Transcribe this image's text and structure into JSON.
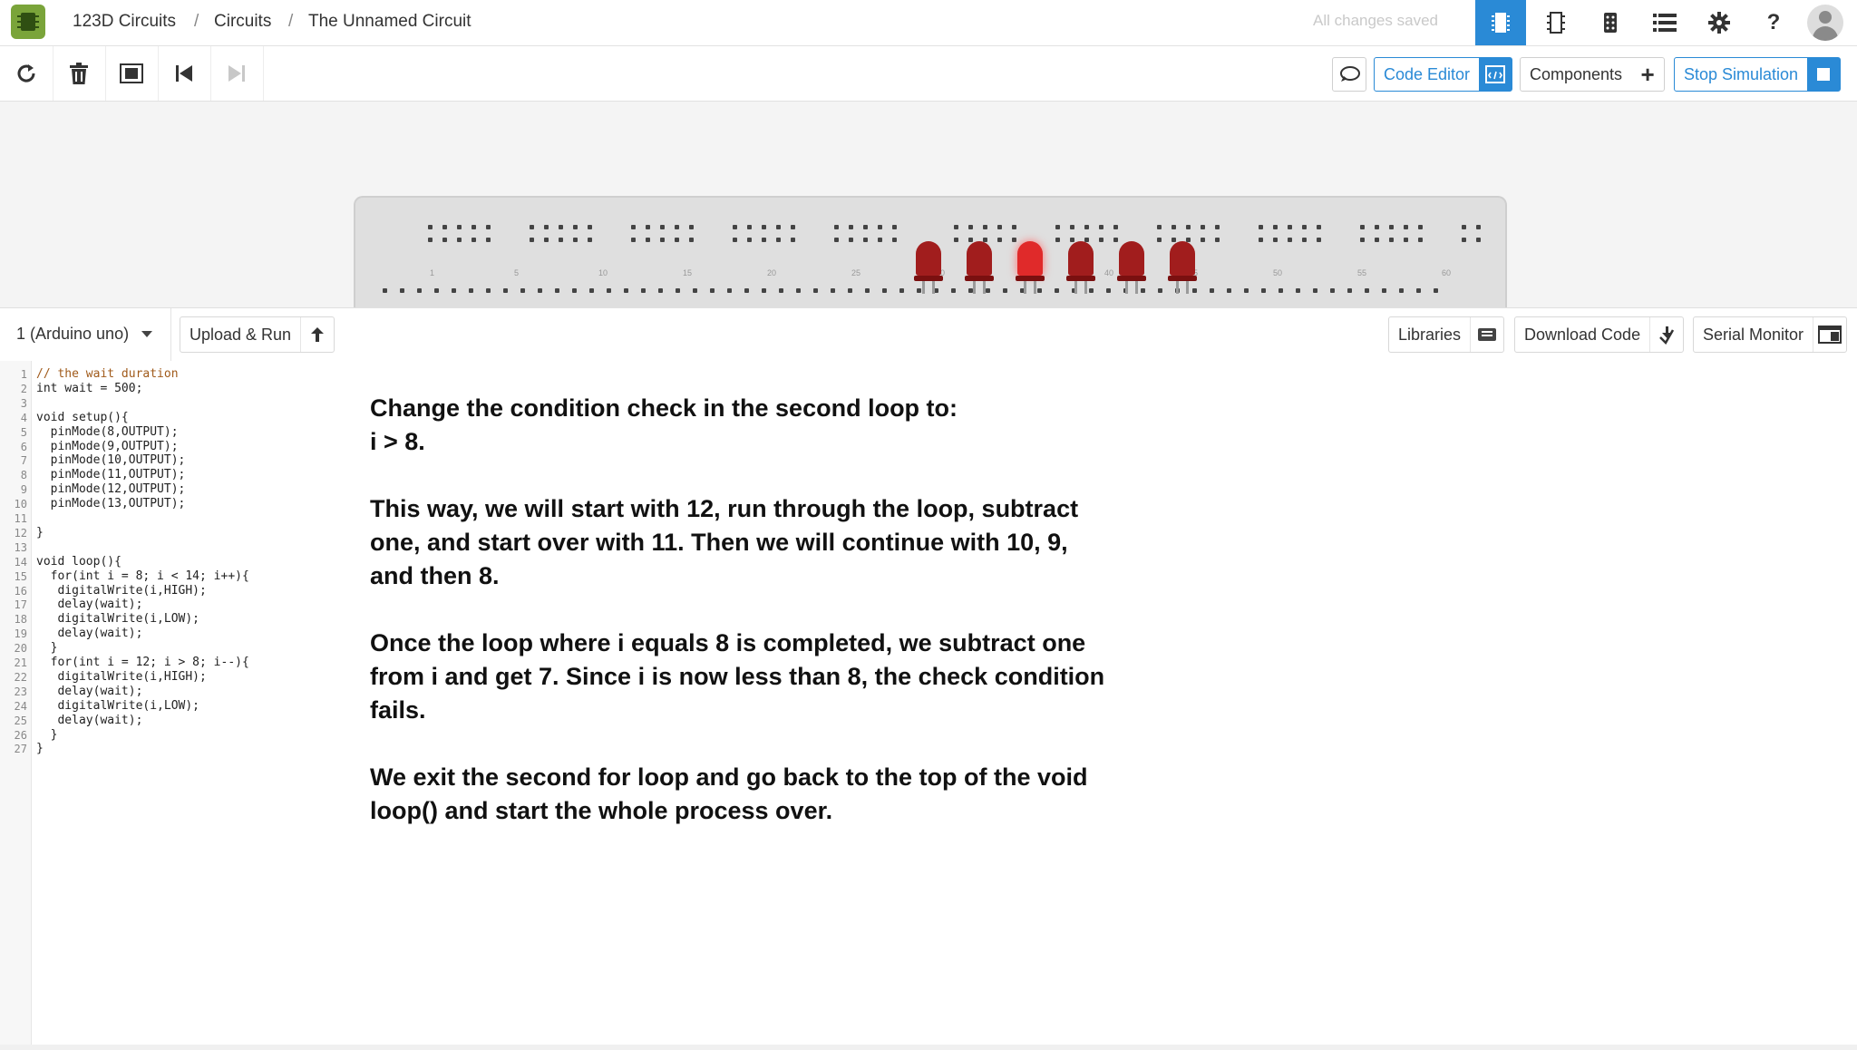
{
  "breadcrumb": {
    "app": "123D Circuits",
    "section": "Circuits",
    "current": "The Unnamed Circuit",
    "separator": "/"
  },
  "status": {
    "saved_text": "All changes saved"
  },
  "top_icons": [
    "breadboard-view-icon",
    "schematic-view-icon",
    "pcb-view-icon",
    "list-view-icon",
    "gear-icon",
    "help-icon"
  ],
  "help_label": "?",
  "toolbar": {
    "code_editor_label": "Code Editor",
    "components_label": "Components",
    "stop_simulation_label": "Stop Simulation",
    "components_plus": "+"
  },
  "codebar": {
    "board_select": "1 (Arduino uno)",
    "upload_run_label": "Upload & Run",
    "libraries_label": "Libraries",
    "download_code_label": "Download Code",
    "serial_monitor_label": "Serial Monitor"
  },
  "breadboard": {
    "column_numbers": [
      "1",
      "5",
      "10",
      "15",
      "20",
      "25",
      "30",
      "35",
      "40",
      "45",
      "50",
      "55",
      "60"
    ],
    "leds": [
      {
        "lit": false
      },
      {
        "lit": false
      },
      {
        "lit": true
      },
      {
        "lit": false
      },
      {
        "lit": false
      },
      {
        "lit": false
      }
    ]
  },
  "code": {
    "lines": [
      "// the wait duration",
      "int wait = 500;",
      "",
      "void setup(){",
      "  pinMode(8,OUTPUT);",
      "  pinMode(9,OUTPUT);",
      "  pinMode(10,OUTPUT);",
      "  pinMode(11,OUTPUT);",
      "  pinMode(12,OUTPUT);",
      "  pinMode(13,OUTPUT);",
      "",
      "}",
      "",
      "void loop(){",
      "  for(int i = 8; i < 14; i++){",
      "   digitalWrite(i,HIGH);",
      "   delay(wait);",
      "   digitalWrite(i,LOW);",
      "   delay(wait);",
      "  }",
      "  for(int i = 12; i > 8; i--){",
      "   digitalWrite(i,HIGH);",
      "   delay(wait);",
      "   digitalWrite(i,LOW);",
      "   delay(wait);",
      "  }",
      "}"
    ]
  },
  "note": {
    "p1a": "Change the condition check in the second loop to:",
    "p1b": "i > 8.",
    "p2": "This way, we will start with 12, run through the loop, subtract one, and start over with 11. Then we will continue with 10, 9, and then 8.",
    "p3": "Once the loop where i equals 8 is completed, we subtract one from i and get 7. Since i is now less than 8, the check condition fails.",
    "p4": "We exit the second for loop and go back to the top of the void loop() and start the whole process over."
  },
  "colors": {
    "accent": "#2a8ad6",
    "led_off": "#a11d1d",
    "led_on": "#e02a2a"
  }
}
